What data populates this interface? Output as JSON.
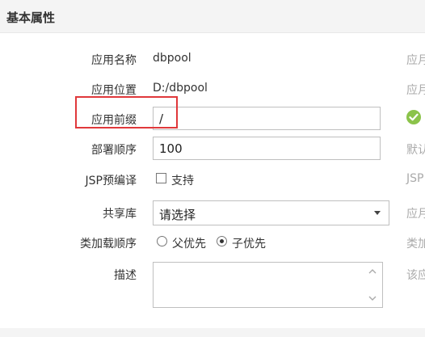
{
  "section": {
    "title": "基本属性"
  },
  "fields": {
    "app_name": {
      "label": "应用名称",
      "value": "dbpool",
      "hint": "应月"
    },
    "app_location": {
      "label": "应用位置",
      "value": "D:/dbpool",
      "hint": "应月"
    },
    "app_prefix": {
      "label": "应用前缀",
      "value": "/"
    },
    "deploy_order": {
      "label": "部署顺序",
      "value": "100",
      "hint": "默认"
    },
    "jsp_precompile": {
      "label": "JSP预编译",
      "option_label": "支持",
      "checked": false,
      "hint": "JSP"
    },
    "shared_lib": {
      "label": "共享库",
      "selected": "请选择",
      "hint": "应月"
    },
    "class_load_order": {
      "label": "类加载顺序",
      "options": [
        {
          "label": "父优先",
          "checked": false
        },
        {
          "label": "子优先",
          "checked": true
        }
      ],
      "hint": "类加"
    },
    "description": {
      "label": "描述",
      "value": "",
      "hint": "该应"
    }
  },
  "colors": {
    "highlight": "#e0383b",
    "valid": "#8bc34a",
    "header_bg": "#f4f4f4"
  },
  "icons": {
    "prefix_status": "check-circle-icon"
  }
}
